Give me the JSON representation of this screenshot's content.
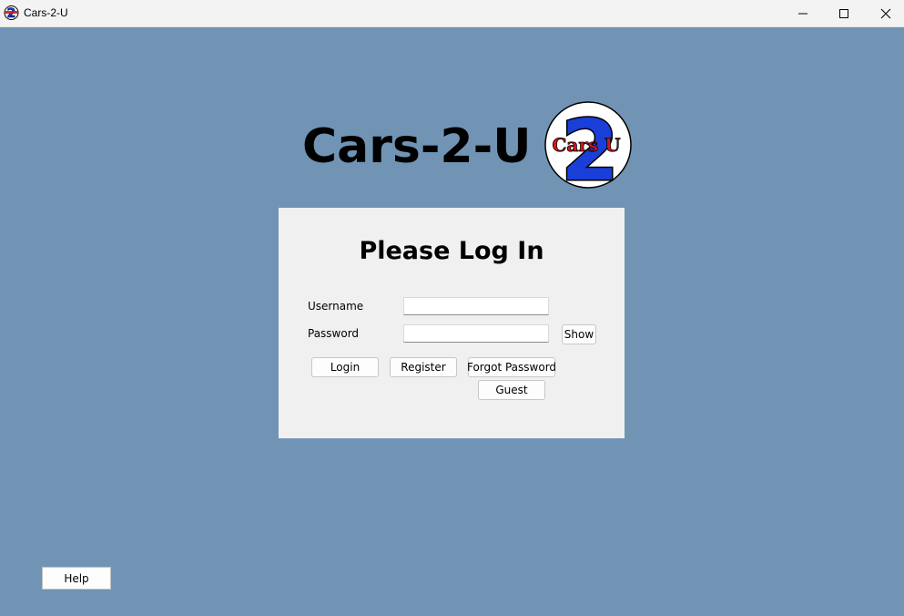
{
  "window": {
    "title": "Cars-2-U",
    "app_icon": "cars-2-u-logo-icon",
    "controls": [
      "minimize-icon",
      "maximize-icon",
      "close-icon"
    ]
  },
  "header": {
    "title": "Cars-2-U",
    "logo_text": "Cars U",
    "logo_numeral": "2"
  },
  "login": {
    "heading": "Please Log In",
    "username_label": "Username",
    "username_value": "",
    "password_label": "Password",
    "password_value": "",
    "show_label": "Show",
    "login_label": "Login",
    "register_label": "Register",
    "forgot_label": "Forgot Password",
    "guest_label": "Guest"
  },
  "footer": {
    "help_label": "Help"
  },
  "colors": {
    "background": "#7194b4",
    "panel": "#f0f0f0",
    "logo_blue": "#1a3fd9",
    "logo_red": "#d8141c"
  }
}
